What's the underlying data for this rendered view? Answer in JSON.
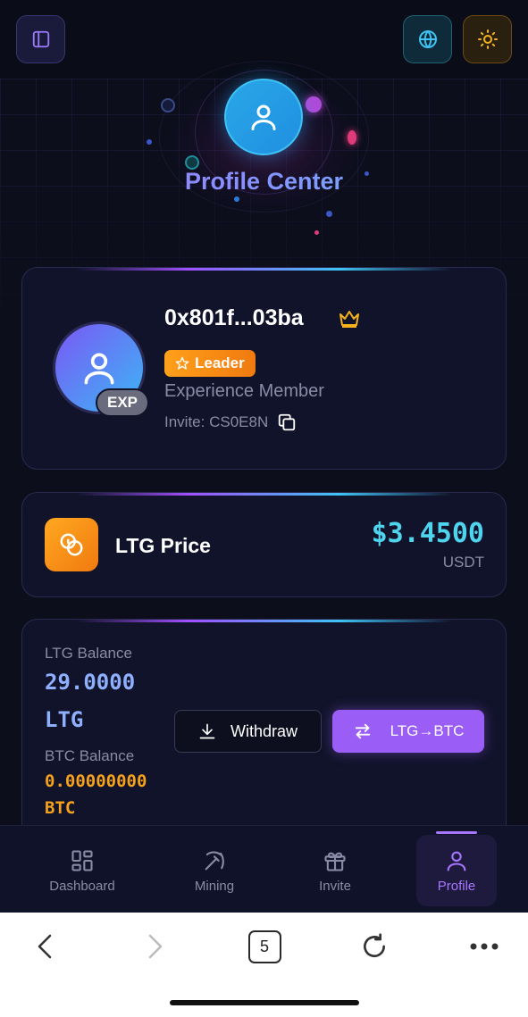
{
  "header": {
    "sidebar_icon": "sidebar-icon",
    "language_icon": "globe-icon",
    "theme_icon": "sun-icon"
  },
  "hero": {
    "title": "Profile Center",
    "avatar_icon": "user-icon"
  },
  "profile": {
    "address": "0x801f...03ba",
    "crown_icon": "crown-icon",
    "badge_label": "Leader",
    "exp_badge": "EXP",
    "member_level": "Experience Member",
    "invite_text": "Invite: CS0E8N",
    "copy_icon": "copy-icon"
  },
  "price": {
    "label": "LTG Price",
    "value": "$3.4500",
    "unit": "USDT"
  },
  "balance": {
    "ltg_label": "LTG Balance",
    "ltg_value": "29.0000",
    "ltg_unit": "LTG",
    "btc_label": "BTC Balance",
    "btc_value": "0.00000000",
    "btc_unit": "BTC",
    "withdraw_label": "Withdraw",
    "swap_label": "LTG→BTC"
  },
  "nav": {
    "items": [
      {
        "label": "Dashboard",
        "icon": "dashboard-icon",
        "active": false
      },
      {
        "label": "Mining",
        "icon": "pickaxe-icon",
        "active": false
      },
      {
        "label": "Invite",
        "icon": "gift-icon",
        "active": false
      },
      {
        "label": "Profile",
        "icon": "user-icon",
        "active": true
      }
    ]
  },
  "browser": {
    "tab_count": "5"
  },
  "colors": {
    "accent_purple": "#a875ff",
    "accent_cyan": "#4fd4ee",
    "accent_orange": "#f7a21b",
    "background": "#0c0e1c"
  }
}
